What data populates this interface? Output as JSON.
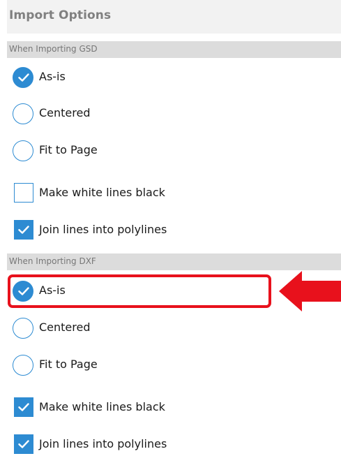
{
  "header": {
    "title": "Import Options"
  },
  "sections": [
    {
      "label": "When Importing GSD",
      "options": [
        {
          "label": "As-is",
          "type": "radio",
          "checked": true
        },
        {
          "label": "Centered",
          "type": "radio",
          "checked": false
        },
        {
          "label": "Fit to Page",
          "type": "radio",
          "checked": false
        },
        {
          "label": "Make white lines black",
          "type": "checkbox",
          "checked": false
        },
        {
          "label": "Join lines into polylines",
          "type": "checkbox",
          "checked": true
        }
      ]
    },
    {
      "label": "When Importing DXF",
      "options": [
        {
          "label": "As-is",
          "type": "radio",
          "checked": true
        },
        {
          "label": "Centered",
          "type": "radio",
          "checked": false
        },
        {
          "label": "Fit to Page",
          "type": "radio",
          "checked": false
        },
        {
          "label": "Make white lines black",
          "type": "checkbox",
          "checked": true
        },
        {
          "label": "Join lines into polylines",
          "type": "checkbox",
          "checked": true
        }
      ]
    }
  ],
  "annotation": {
    "highlight_color": "#e8111c",
    "arrow_icon": "red-arrow-left-icon"
  },
  "colors": {
    "accent": "#2d8bd2",
    "header_bg": "#f2f2f2",
    "section_bg": "#dcdcdc"
  }
}
